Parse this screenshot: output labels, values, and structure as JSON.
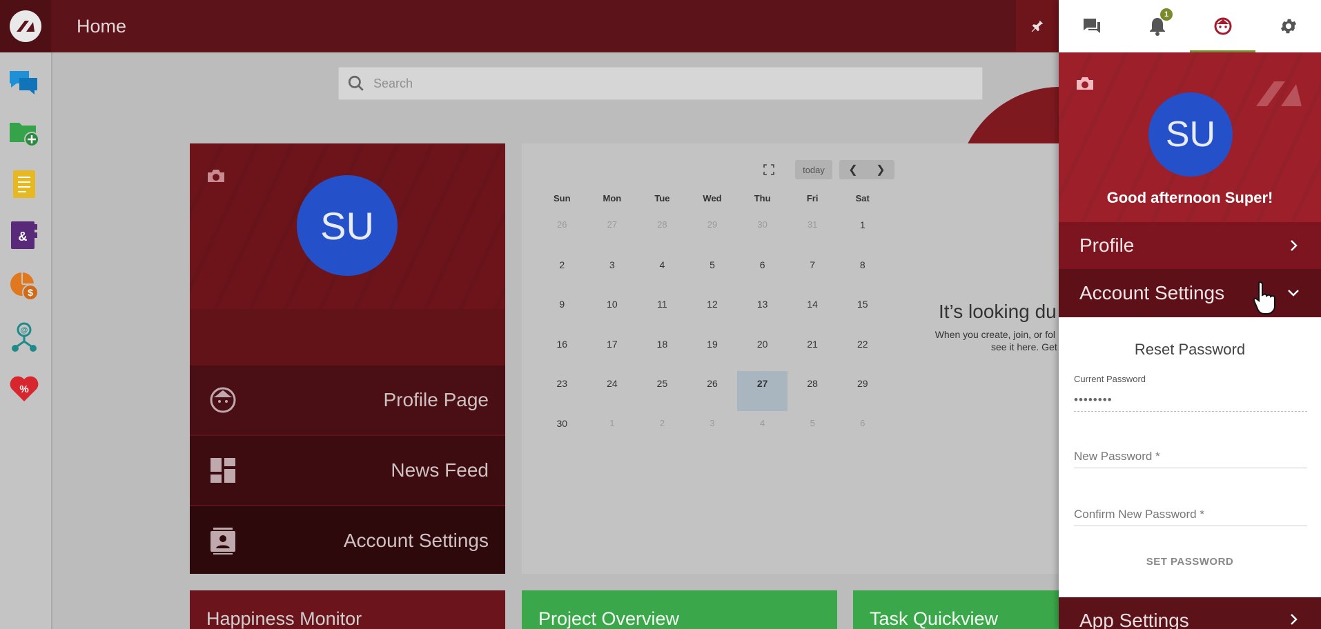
{
  "header": {
    "title": "Home"
  },
  "search": {
    "placeholder": "Search"
  },
  "profile_card": {
    "initials": "SU",
    "items": [
      {
        "label": "Profile Page",
        "icon": "face-icon"
      },
      {
        "label": "News Feed",
        "icon": "dashboard-icon"
      },
      {
        "label": "Account Settings",
        "icon": "contact-card-icon"
      }
    ]
  },
  "calendar": {
    "today_label": "today",
    "weekdays": [
      "Sun",
      "Mon",
      "Tue",
      "Wed",
      "Thu",
      "Fri",
      "Sat"
    ],
    "weeks": [
      [
        "26",
        "27",
        "28",
        "29",
        "30",
        "31",
        "1"
      ],
      [
        "2",
        "3",
        "4",
        "5",
        "6",
        "7",
        "8"
      ],
      [
        "9",
        "10",
        "11",
        "12",
        "13",
        "14",
        "15"
      ],
      [
        "16",
        "17",
        "18",
        "19",
        "20",
        "21",
        "22"
      ],
      [
        "23",
        "24",
        "25",
        "26",
        "27",
        "28",
        "29"
      ],
      [
        "30",
        "1",
        "2",
        "3",
        "4",
        "5",
        "6"
      ]
    ],
    "today": "27",
    "empty_title": "It’s looking du",
    "empty_sub_1": "When you create, join, or fol",
    "empty_sub_2": "see it here. Get"
  },
  "bottom_cards": [
    {
      "title": "Happiness Monitor",
      "color": "#6b141b"
    },
    {
      "title": "Project Overview",
      "color": "#3aa84a"
    },
    {
      "title": "Task Quickview",
      "color": "#3aa84a"
    }
  ],
  "right_panel": {
    "tabs": [
      "chat-icon",
      "bell-icon",
      "face-icon",
      "gear-icon"
    ],
    "notification_count": "1",
    "initials": "SU",
    "greeting": "Good afternoon Super!",
    "profile_label": "Profile",
    "account_settings_label": "Account Settings",
    "reset_title": "Reset Password",
    "current_password_label": "Current Password",
    "current_password_value": "••••••••",
    "new_password_placeholder": "New Password *",
    "confirm_password_placeholder": "Confirm New Password *",
    "set_password_label": "SET PASSWORD",
    "app_settings_label": "App Settings"
  },
  "colors": {
    "brand": "#5c1319",
    "accent": "#2451c9",
    "active_tab": "#7d8a2e"
  }
}
